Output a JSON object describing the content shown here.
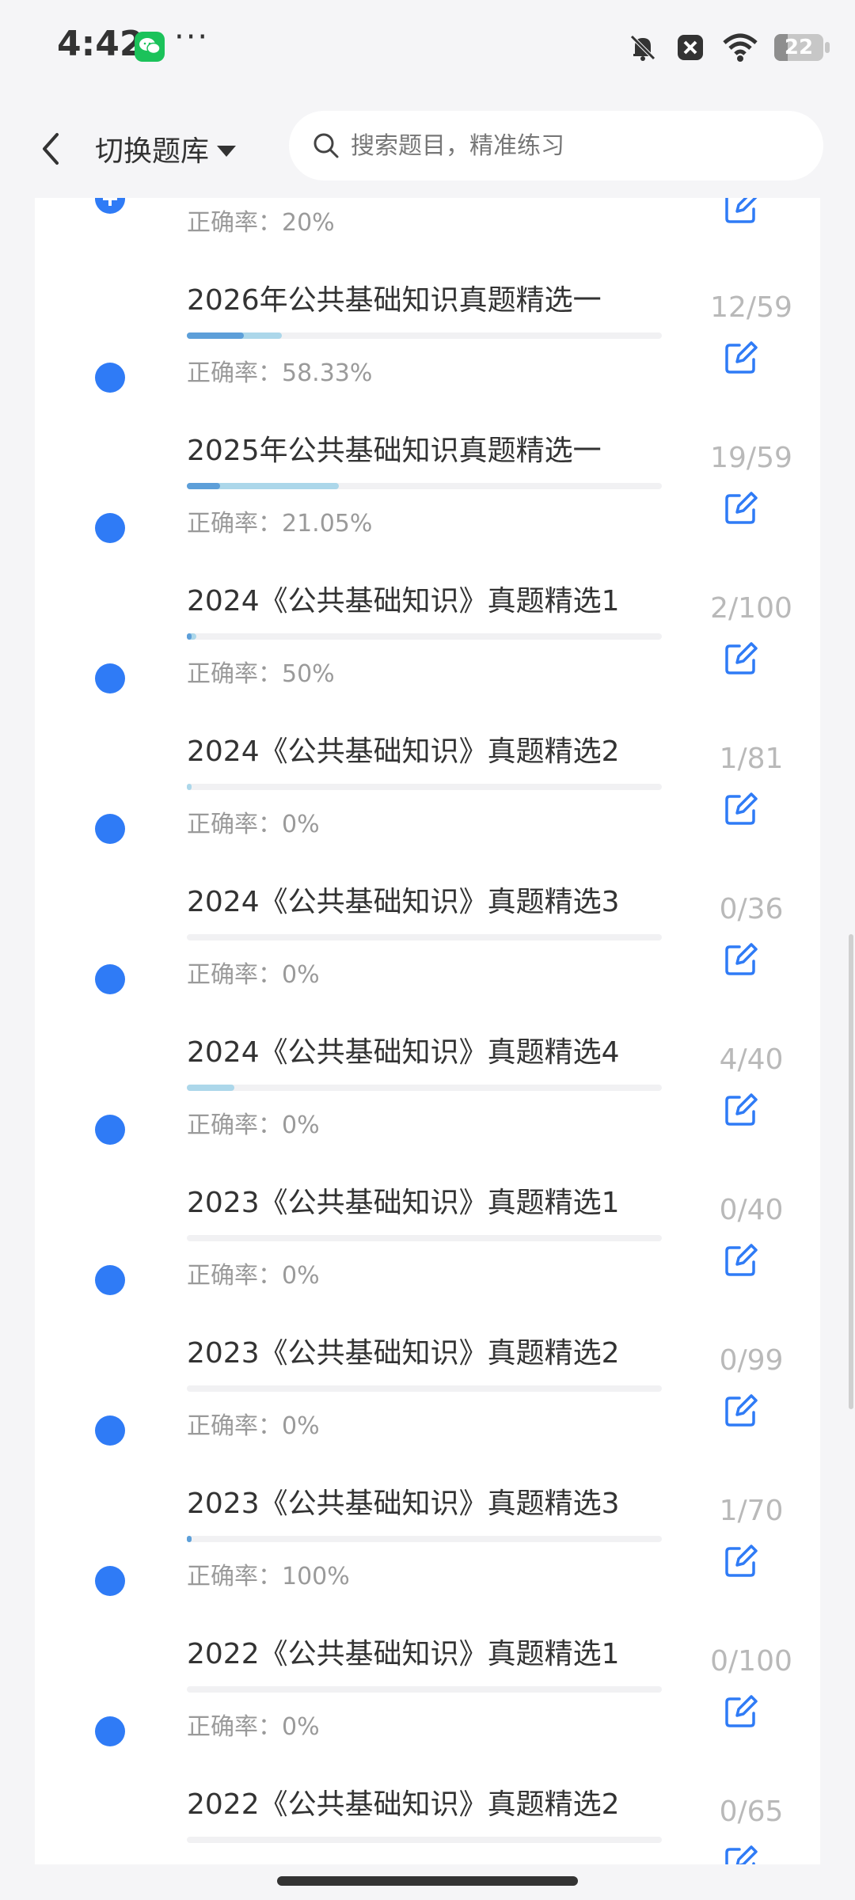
{
  "status_bar": {
    "time": "4:42",
    "dots": "···",
    "battery": "22"
  },
  "header": {
    "title": "切换题库",
    "search_placeholder": "搜索题目，精准练习"
  },
  "list": [
    {
      "title": "",
      "accuracy": "正确率：20%",
      "count": "",
      "progress": 0.05,
      "bg": 0.05
    },
    {
      "title": "2026年公共基础知识真题精选一",
      "accuracy": "正确率：58.33%",
      "count": "12/59",
      "progress": 0.12,
      "bg": 0.2
    },
    {
      "title": "2025年公共基础知识真题精选一",
      "accuracy": "正确率：21.05%",
      "count": "19/59",
      "progress": 0.07,
      "bg": 0.32
    },
    {
      "title": "2024《公共基础知识》真题精选1",
      "accuracy": "正确率：50%",
      "count": "2/100",
      "progress": 0.01,
      "bg": 0.02
    },
    {
      "title": "2024《公共基础知识》真题精选2",
      "accuracy": "正确率：0%",
      "count": "1/81",
      "progress": 0.0,
      "bg": 0.01
    },
    {
      "title": "2024《公共基础知识》真题精选3",
      "accuracy": "正确率：0%",
      "count": "0/36",
      "progress": 0.0,
      "bg": 0.0
    },
    {
      "title": "2024《公共基础知识》真题精选4",
      "accuracy": "正确率：0%",
      "count": "4/40",
      "progress": 0.0,
      "bg": 0.1
    },
    {
      "title": "2023《公共基础知识》真题精选1",
      "accuracy": "正确率：0%",
      "count": "0/40",
      "progress": 0.0,
      "bg": 0.0
    },
    {
      "title": "2023《公共基础知识》真题精选2",
      "accuracy": "正确率：0%",
      "count": "0/99",
      "progress": 0.0,
      "bg": 0.0
    },
    {
      "title": "2023《公共基础知识》真题精选3",
      "accuracy": "正确率：100%",
      "count": "1/70",
      "progress": 0.01,
      "bg": 0.01
    },
    {
      "title": "2022《公共基础知识》真题精选1",
      "accuracy": "正确率：0%",
      "count": "0/100",
      "progress": 0.0,
      "bg": 0.0
    },
    {
      "title": "2022《公共基础知识》真题精选2",
      "accuracy": "",
      "count": "0/65",
      "progress": 0.0,
      "bg": 0.0
    }
  ]
}
